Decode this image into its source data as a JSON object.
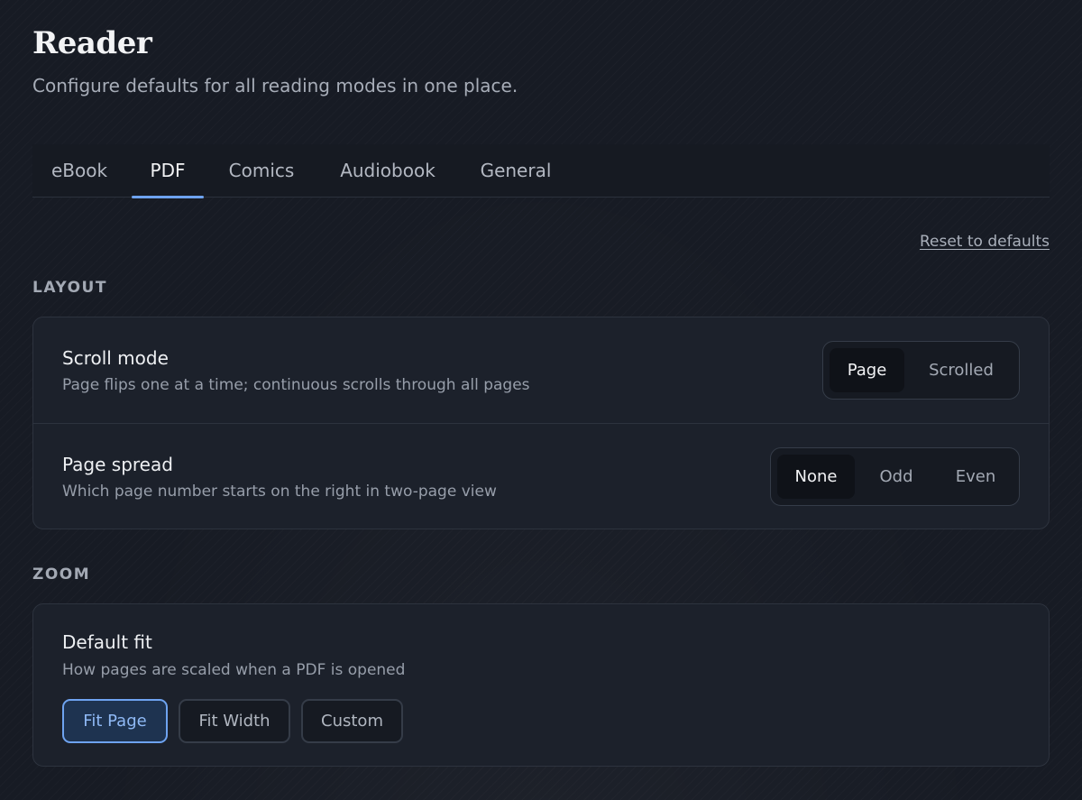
{
  "header": {
    "title": "Reader",
    "subtitle": "Configure defaults for all reading modes in one place."
  },
  "tabs": [
    {
      "label": "eBook",
      "active": false
    },
    {
      "label": "PDF",
      "active": true
    },
    {
      "label": "Comics",
      "active": false
    },
    {
      "label": "Audiobook",
      "active": false
    },
    {
      "label": "General",
      "active": false
    }
  ],
  "reset_label": "Reset to defaults",
  "layout": {
    "label": "LAYOUT",
    "scroll_mode": {
      "title": "Scroll mode",
      "description": "Page flips one at a time; continuous scrolls through all pages",
      "options": [
        "Page",
        "Scrolled"
      ],
      "selected": "Page"
    },
    "page_spread": {
      "title": "Page spread",
      "description": "Which page number starts on the right in two-page view",
      "options": [
        "None",
        "Odd",
        "Even"
      ],
      "selected": "None"
    }
  },
  "zoom": {
    "label": "ZOOM",
    "default_fit": {
      "title": "Default fit",
      "description": "How pages are scaled when a PDF is opened",
      "options": [
        "Fit Page",
        "Fit Width",
        "Custom"
      ],
      "selected": "Fit Page"
    }
  },
  "colors": {
    "accent": "#6ea3f0",
    "background": "#171b24",
    "card": "#1c212b"
  }
}
